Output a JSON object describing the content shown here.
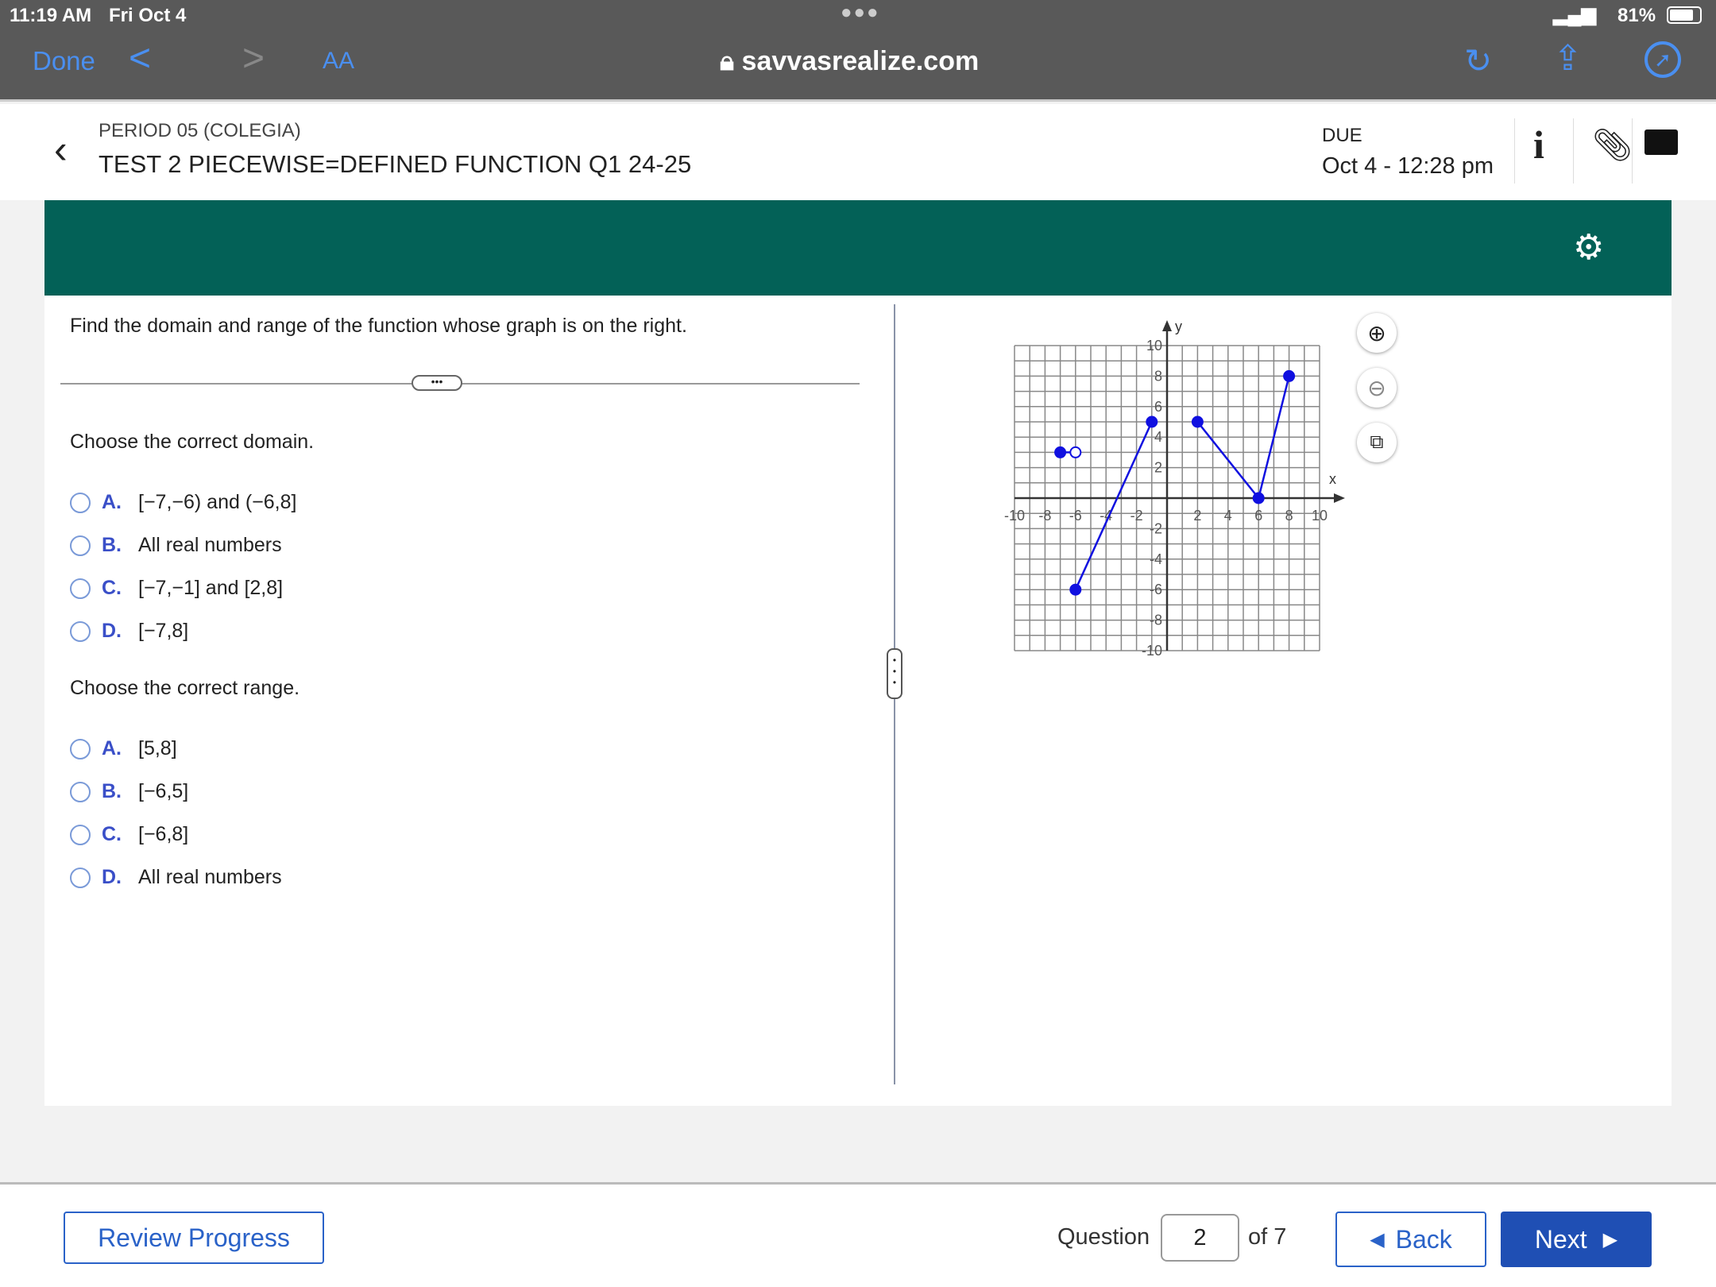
{
  "status": {
    "time": "11:19 AM",
    "date": "Fri Oct 4",
    "battery": "81%"
  },
  "browser": {
    "done": "Done",
    "text_size": "AA",
    "url": "savvasrealize.com"
  },
  "header": {
    "class": "PERIOD 05 (COLEGIA)",
    "title": "TEST 2 PIECEWISE=DEFINED FUNCTION Q1 24-25",
    "due_label": "DUE",
    "due_value": "Oct 4 - 12:28 pm"
  },
  "question": {
    "prompt": "Find the domain and range of the function whose graph is on the right.",
    "domain_heading": "Choose the correct domain.",
    "domain_options": [
      {
        "letter": "A.",
        "text": "[−7,−6) and (−6,8]"
      },
      {
        "letter": "B.",
        "text": "All real numbers"
      },
      {
        "letter": "C.",
        "text": "[−7,−1] and [2,8]"
      },
      {
        "letter": "D.",
        "text": "[−7,8]"
      }
    ],
    "range_heading": "Choose the correct range.",
    "range_options": [
      {
        "letter": "A.",
        "text": "[5,8]"
      },
      {
        "letter": "B.",
        "text": "[−6,5]"
      },
      {
        "letter": "C.",
        "text": "[−6,8]"
      },
      {
        "letter": "D.",
        "text": "All real numbers"
      }
    ]
  },
  "chart_data": {
    "type": "line",
    "xlabel": "x",
    "ylabel": "y",
    "xlim": [
      -10,
      10
    ],
    "ylim": [
      -10,
      10
    ],
    "grid": true,
    "x_ticks": [
      "-10",
      "-8",
      "-6",
      "-4",
      "-2",
      "2",
      "4",
      "6",
      "8",
      "10"
    ],
    "y_ticks": [
      "10",
      "8",
      "6",
      "4",
      "2",
      "-2",
      "-4",
      "-6",
      "-8",
      "-10"
    ],
    "segments": [
      {
        "points": [
          [
            -7,
            3
          ],
          [
            -6,
            3
          ]
        ],
        "closed": [
          true,
          false
        ]
      },
      {
        "points": [
          [
            -6,
            -6
          ],
          [
            -1,
            5
          ]
        ],
        "closed": [
          true,
          true
        ]
      },
      {
        "points": [
          [
            2,
            5
          ],
          [
            6,
            0
          ],
          [
            8,
            8
          ]
        ],
        "closed": [
          true,
          true,
          true
        ]
      }
    ],
    "color": "#1010e0"
  },
  "footer": {
    "review": "Review Progress",
    "question_label": "Question",
    "question_num": "2",
    "of_total": "of 7",
    "back": "Back",
    "next": "Next"
  }
}
